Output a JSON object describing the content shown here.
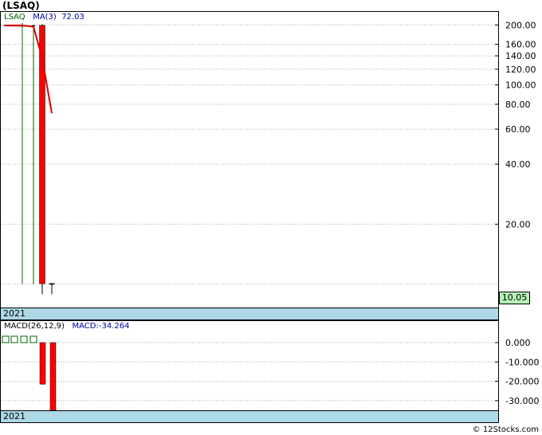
{
  "title": "(LSAQ)",
  "legend": {
    "ticker": "LSAQ",
    "ma_label": "MA(3)",
    "ma_value": "72.03",
    "macd_label": "MACD(26,12,9)",
    "macd_value": "MACD:-34.264"
  },
  "year_label": "2021",
  "last_price_label": "10.05",
  "footer": "© 12Stocks.com",
  "colors": {
    "up": "#006400",
    "down": "#ff0000",
    "ma": "#dd0000",
    "grid": "#aaaaaa",
    "axis_band": "#add8e6",
    "last_bg": "#b4f0b4"
  },
  "chart_data": [
    {
      "type": "candlestick",
      "scale": "log",
      "ylim": [
        8.6,
        220
      ],
      "yticks": [
        10,
        20,
        40,
        60,
        80,
        100,
        120,
        140,
        160,
        200
      ],
      "ytick_labels": [
        "",
        "20.00",
        "40.00",
        "60.00",
        "80.00",
        "100.00",
        "120.00",
        "140.00",
        "160.00",
        "200.00"
      ],
      "candles": [
        {
          "o": 199,
          "h": 200,
          "l": 198,
          "c": 199.5,
          "color": "down"
        },
        {
          "o": 199,
          "h": 200,
          "l": 198,
          "c": 199,
          "color": "down"
        },
        {
          "o": 199,
          "h": 200,
          "l": 198,
          "c": 199,
          "color": "down"
        },
        {
          "o": 199,
          "h": 200,
          "l": 198,
          "c": 199.5,
          "color": "down"
        },
        {
          "o": 199,
          "h": 200,
          "l": 198,
          "c": 199,
          "color": "down"
        },
        {
          "o": 199,
          "h": 200,
          "l": 198,
          "c": 199,
          "color": "down"
        },
        {
          "o": 199,
          "h": 205,
          "l": 10,
          "c": 199,
          "color": "up"
        },
        {
          "o": 199,
          "h": 200,
          "l": 10,
          "c": 198,
          "color": "up"
        },
        {
          "o": 199,
          "h": 202,
          "l": 8.9,
          "c": 10.05,
          "color": "down"
        },
        {
          "o": 10.05,
          "h": 10.1,
          "l": 8.9,
          "c": 10.05,
          "color": "black"
        }
      ],
      "ma": [
        199,
        199,
        199,
        199,
        199,
        199,
        199,
        196,
        136,
        72.03
      ],
      "last": 10.05
    },
    {
      "type": "bar",
      "title": "MACD(26,12,9)",
      "ylim": [
        -35,
        7
      ],
      "yticks": [
        0,
        -10,
        -20,
        -30
      ],
      "ytick_labels": [
        "0.000",
        "-10.000",
        "-20.000",
        "-30.000"
      ],
      "values": [
        0,
        0,
        0,
        0,
        -21.5,
        -35
      ],
      "signal_boxes": [
        1,
        1,
        1,
        1,
        0,
        0
      ]
    }
  ]
}
